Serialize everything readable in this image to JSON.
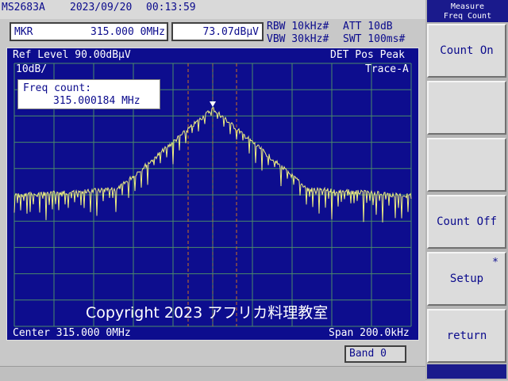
{
  "status": {
    "model": "MS2683A",
    "date": "2023/09/20",
    "time": "00:13:59"
  },
  "marker": {
    "label": "MKR",
    "frequency": "315.000 0MHz",
    "level": "73.07dBμV"
  },
  "settings": {
    "rbw": "RBW 10kHz#",
    "vbw": "VBW 30kHz#",
    "att": "ATT 10dB",
    "swt": "SWT 100ms#"
  },
  "screen": {
    "ref_level": "Ref Level  90.00dBμV",
    "detector": "DET  Pos Peak",
    "scale": "10dB/",
    "trace": "Trace-A",
    "center": "Center 315.000 0MHz",
    "span": "Span 200.0kHz",
    "freq_count_label": "Freq count:",
    "freq_count_value": "315.000184 MHz",
    "copyright": "Copyright 2023 アフリカ料理教室"
  },
  "band": "Band 0",
  "softkeys": {
    "header_line1": "Measure",
    "header_line2": "Freq Count",
    "items": [
      {
        "label": "Count On",
        "star": ""
      },
      {
        "label": "",
        "star": ""
      },
      {
        "label": "",
        "star": ""
      },
      {
        "label": "Count Off",
        "star": ""
      },
      {
        "label": "Setup",
        "star": "*"
      },
      {
        "label": "return",
        "star": ""
      }
    ]
  },
  "colors": {
    "screen_bg": "#0d0d8e",
    "grid": "#4a8a6a",
    "trace": "#f0f080",
    "marker_lines": "#d07020"
  }
}
